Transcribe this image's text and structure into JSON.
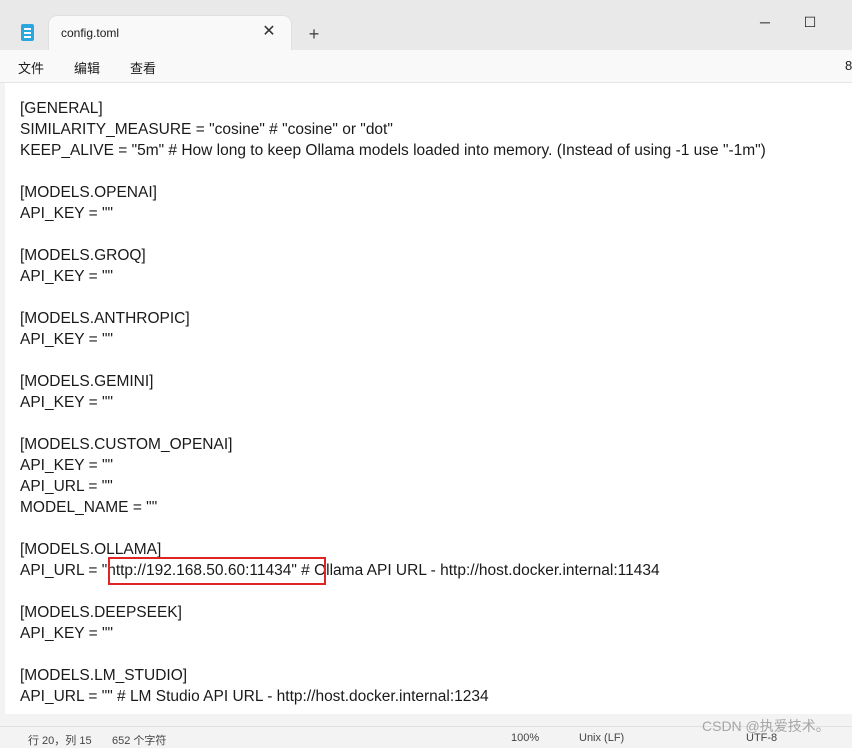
{
  "app": {
    "tab_title": "config.toml",
    "tab_close_glyph": "✕",
    "new_tab_glyph": "+",
    "icon": "notepad-icon"
  },
  "window_controls": {
    "minimize": "─",
    "maximize": "☐",
    "close": "✕"
  },
  "menu": {
    "items": [
      "文件",
      "编辑",
      "查看"
    ],
    "overflow_text": "8"
  },
  "editor": {
    "lines": [
      "[GENERAL]",
      "SIMILARITY_MEASURE = \"cosine\" # \"cosine\" or \"dot\"",
      "KEEP_ALIVE = \"5m\" # How long to keep Ollama models loaded into memory. (Instead of using -1 use \"-1m\")",
      "",
      "[MODELS.OPENAI]",
      "API_KEY = \"\"",
      "",
      "[MODELS.GROQ]",
      "API_KEY = \"\"",
      "",
      "[MODELS.ANTHROPIC]",
      "API_KEY = \"\"",
      "",
      "[MODELS.GEMINI]",
      "API_KEY = \"\"",
      "",
      "[MODELS.CUSTOM_OPENAI]",
      "API_KEY = \"\"",
      "API_URL = \"\"",
      "MODEL_NAME = \"\"",
      "",
      "[MODELS.OLLAMA]",
      "API_URL = \"http://192.168.50.60:11434\" # Ollama API URL - http://host.docker.internal:11434",
      "",
      "[MODELS.DEEPSEEK]",
      "API_KEY = \"\"",
      "",
      "[MODELS.LM_STUDIO]",
      "API_URL = \"\" # LM Studio API URL - http://host.docker.internal:1234"
    ],
    "highlight_color": "#e02424"
  },
  "status": {
    "position": "行 20，列 15",
    "char_count": "652 个字符",
    "zoom": "100%",
    "line_ending": "Unix (LF)",
    "encoding": "UTF-8"
  },
  "watermark": "CSDN @执爱技术。"
}
